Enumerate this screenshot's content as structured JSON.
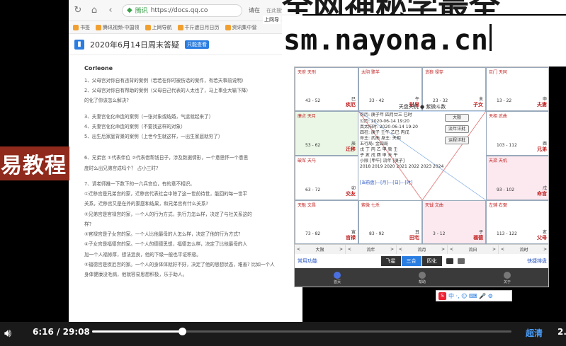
{
  "browser": {
    "url": "https://docs.qq.co",
    "url_site": "腾讯",
    "right_label": "请在",
    "search_hint": "在此搜索",
    "bookmarks": [
      "书签",
      "腾讯视频-中国领",
      "上网导航",
      "千斤遮日月日历",
      "资讯集中营"
    ],
    "doc_title": "2020年6月14日周末答疑",
    "doc_badge": "只能查看",
    "author": "Corleone",
    "paragraphs": [
      "1、父母宫对你自有违背的案例（若若在你时被伤话的案件，有若天事前说明）",
      "2、父母宫对你自有帮助的案例（父母自己代表的人太也了，马上事业大输下降）",
      "的化了你该怎么解决?",
      "3、夫妻宫化化命造的案例（一张对象或结婚，气运就起来了）",
      "4、夫妻宫化化命造的案例（不要找这样的对象）",
      "5、出生后家庭背景的案例（上世今生就这样，一出生家庭就穷了）",
      "6、兄弟宫 ①代表伴位 ②代表借帮钱日子，涉及数据情形，一个意思怀一个意思",
      "度时么出兄弟宫成吗个？ 占小三时?",
      "7、请老师推一下数下的一六兵宫位，有的意不相识。",
      "①迁移宫是兄弟宫的家，迁移宫代表社会中除了这一世前待世，能回的每一世平",
      "关系，迁移宫又是在外的家庭和结果，和兄弟宫有什么关系?",
      "②兄弟宫是官禄宫的家，一个人的行为方式，执行力怎么样，决定了与社关系这的",
      "样?",
      "③官禄宫是子女宫的家。一个人比他最母的人怎么样，决定了他的行为方式?",
      "④子女宫是福德宫的家。一个人的德德思想，福德怎么样，决定了比他最母的人",
      "加一个人福修厚，想法造良，他的下级一般也平证积极。",
      "⑤福德宫是疾厄宫的家。一个人的身体体就好不好，决定了他的思想状态，难善? 比如一个人",
      "身体健康没毛病，他就容易思想积极，乐于助人。"
    ]
  },
  "promo_banner": "易教程",
  "overlay": {
    "title": "全网神秘学最全",
    "url": "sm.nayona.cn",
    "screen_tag": "上网导"
  },
  "astro": {
    "palaces": [
      {
        "stars": "天府 天刑",
        "nums": "43 - 52",
        "branch": "巳",
        "name": "疾厄"
      },
      {
        "stars": "太阴 擎羊",
        "nums": "33 - 42",
        "branch": "午",
        "name": "财帛"
      },
      {
        "stars": "贪狼 禄存",
        "nums": "23 - 32",
        "branch": "未",
        "name": "子女"
      },
      {
        "stars": "巨门 天同",
        "nums": "13 - 22",
        "branch": "申",
        "name": "夫妻"
      },
      {
        "stars": "廉贞 天月",
        "nums": "53 - 62",
        "branch": "辰",
        "name": "迁移"
      },
      {
        "stars": "天相 武曲",
        "nums": "103 - 112",
        "branch": "酉",
        "name": "兄弟"
      },
      {
        "stars": "破军 天马",
        "nums": "63 - 72",
        "branch": "卯",
        "name": "交友"
      },
      {
        "stars": "天梁 天机",
        "nums": "93 - 102",
        "branch": "戌",
        "name": "命宫"
      },
      {
        "stars": "天魁 文昌",
        "nums": "73 - 82",
        "branch": "寅",
        "name": "官禄"
      },
      {
        "stars": "紫微 七杀",
        "nums": "83 - 92",
        "branch": "丑",
        "name": "田宅"
      },
      {
        "stars": "天钺 文曲",
        "nums": "3 - 12",
        "branch": "子",
        "name": "福德"
      },
      {
        "stars": "左辅 右弼",
        "nums": "113 - 122",
        "branch": "亥",
        "name": "父母"
      }
    ],
    "center": {
      "title": "天盘天机 ● 紫微斗数",
      "lines": [
        "农历: 庚子年 四月廿三 巳时",
        "公历: 2020-06-14 19:20",
        "真太阳时: 2020-06-14 19:20",
        "四柱: 庚子 壬午 乙巳 丙戌",
        "命主: 武曲  身主: 天相",
        "五行局: 金四局",
        "戊  丁  丙  乙  甲  癸  壬",
        "子  亥  戌  酉  申  未  午",
        "小限 [甲午] 流年 [庚子]",
        "2018 2019 2020 2021 2022 2023 2024"
      ],
      "blue_row": "[当前盘]---[月]---[日]---[时]"
    },
    "side_buttons": [
      "大限",
      "流年详批",
      "运程详批"
    ],
    "nav_cells": [
      {
        "prev": "<",
        "label": "大限",
        "next": ">"
      },
      {
        "prev": "<",
        "label": "流年",
        "next": ">"
      },
      {
        "prev": "<",
        "label": "流月",
        "next": ">"
      },
      {
        "prev": "<",
        "label": "流日",
        "next": ">"
      },
      {
        "prev": "<",
        "label": "流时",
        "next": ">"
      }
    ],
    "func_link": "常用功能",
    "tabs": [
      "飞星",
      "三合",
      "四化"
    ],
    "active_tab": "三合",
    "quick_link": "快捷排盘",
    "bottom_nav": [
      "首页",
      "帮助",
      "关于"
    ]
  },
  "ime": {
    "logo": "S",
    "label": "中 ·, ☺ ⌨ 🎤 ⚙"
  },
  "player": {
    "time_current": "6:16",
    "time_total": "29:08",
    "time_sep": "/",
    "quality": "超清",
    "speed": "2.",
    "progress": 0.215
  }
}
